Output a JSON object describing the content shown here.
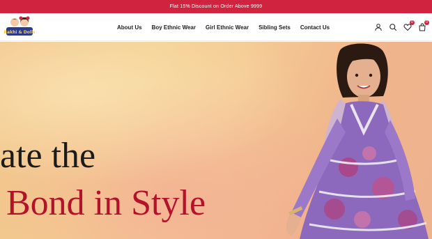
{
  "announcement": {
    "text": "Flat 15% Discount on Order Above 9999"
  },
  "brand": {
    "logo_text": "Rakhi & Dolls"
  },
  "nav": {
    "items": [
      {
        "label": "About Us"
      },
      {
        "label": "Boy Ethnic Wear"
      },
      {
        "label": "Girl Ethnic Wear"
      },
      {
        "label": "Sibling Sets"
      },
      {
        "label": "Contact Us"
      }
    ]
  },
  "header_icons": {
    "account": "user-icon",
    "search": "search-icon",
    "wishlist": {
      "icon": "heart-icon",
      "count": "0"
    },
    "cart": {
      "icon": "bag-icon",
      "count": "0"
    }
  },
  "hero": {
    "line1": "ate the",
    "line2": "Bond in Style"
  },
  "colors": {
    "accent": "#d0233f",
    "headline_dark": "#1b1b1b",
    "headline_red": "#b3122a"
  }
}
